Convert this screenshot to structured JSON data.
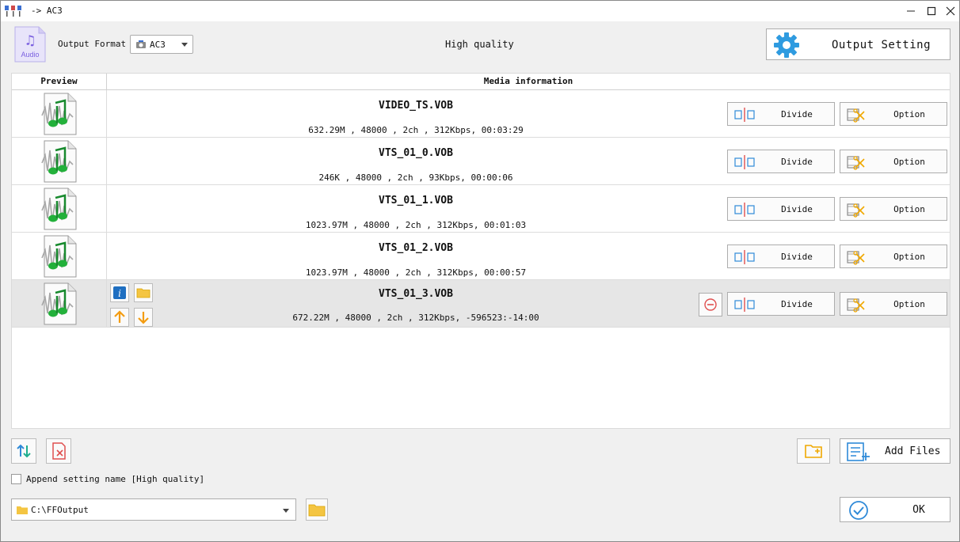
{
  "window": {
    "title": "-> AC3",
    "controls": [
      "minimize",
      "maximize",
      "close"
    ]
  },
  "toolbar": {
    "audio_icon_label": "Audio",
    "output_format_label": "Output Format",
    "output_format_value": "AC3",
    "quality_label": "High quality",
    "output_setting_label": "Output Setting"
  },
  "table": {
    "headers": {
      "preview": "Preview",
      "media": "Media information"
    },
    "rows": [
      {
        "name": "VIDEO_TS.VOB",
        "info": "632.29M , 48000 , 2ch , 312Kbps, 00:03:29",
        "divide": "Divide",
        "option": "Option"
      },
      {
        "name": "VTS_01_0.VOB",
        "info": "246K , 48000 , 2ch , 93Kbps, 00:00:06",
        "divide": "Divide",
        "option": "Option"
      },
      {
        "name": "VTS_01_1.VOB",
        "info": "1023.97M , 48000 , 2ch , 312Kbps, 00:01:03",
        "divide": "Divide",
        "option": "Option"
      },
      {
        "name": "VTS_01_2.VOB",
        "info": "1023.97M , 48000 , 2ch , 312Kbps, 00:00:57",
        "divide": "Divide",
        "option": "Option"
      },
      {
        "name": "VTS_01_3.VOB",
        "info": "672.22M , 48000 , 2ch , 312Kbps, -596523:-14:00",
        "divide": "Divide",
        "option": "Option",
        "selected": true
      }
    ]
  },
  "bottom": {
    "add_files_label": "Add Files",
    "append_label": "Append setting name [High quality]",
    "append_checked": false,
    "output_path": "C:\\FFOutput",
    "ok_label": "OK"
  },
  "colors": {
    "accent_blue": "#2f8ad8",
    "icon_folder": "#f4c542",
    "arrow_orange": "#f39c12",
    "remove_red": "#e05050"
  }
}
